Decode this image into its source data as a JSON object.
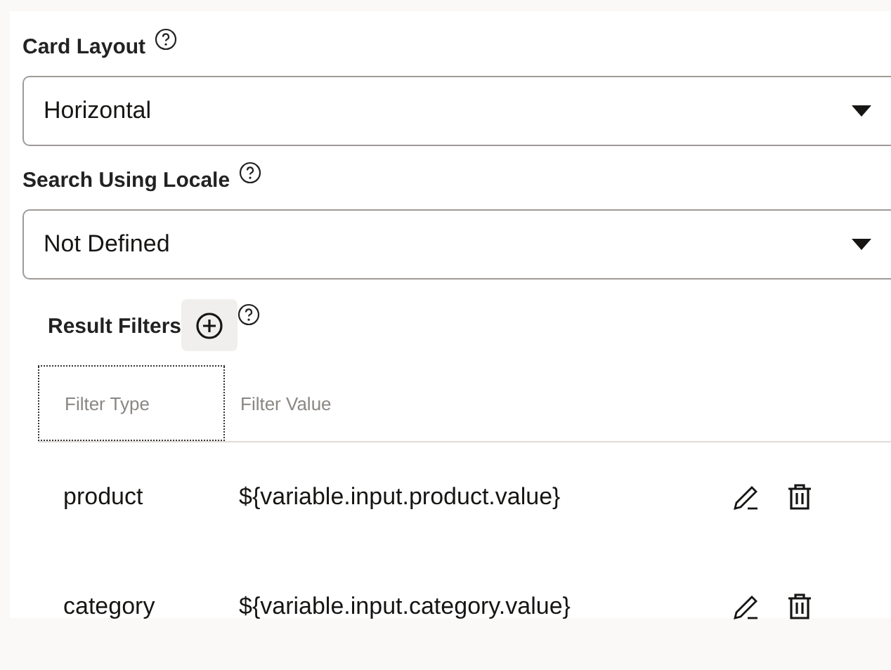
{
  "fields": [
    {
      "label": "Card Layout",
      "value": "Horizontal"
    },
    {
      "label": "Search Using Locale",
      "value": "Not Defined"
    }
  ],
  "result_filters": {
    "label": "Result Filters",
    "columns": [
      {
        "label": "Filter Type",
        "focused": true
      },
      {
        "label": "Filter Value",
        "focused": false
      }
    ],
    "rows": [
      {
        "type": "product",
        "value": "${variable.input.product.value}"
      },
      {
        "type": "category",
        "value": "${variable.input.category.value}"
      }
    ]
  }
}
